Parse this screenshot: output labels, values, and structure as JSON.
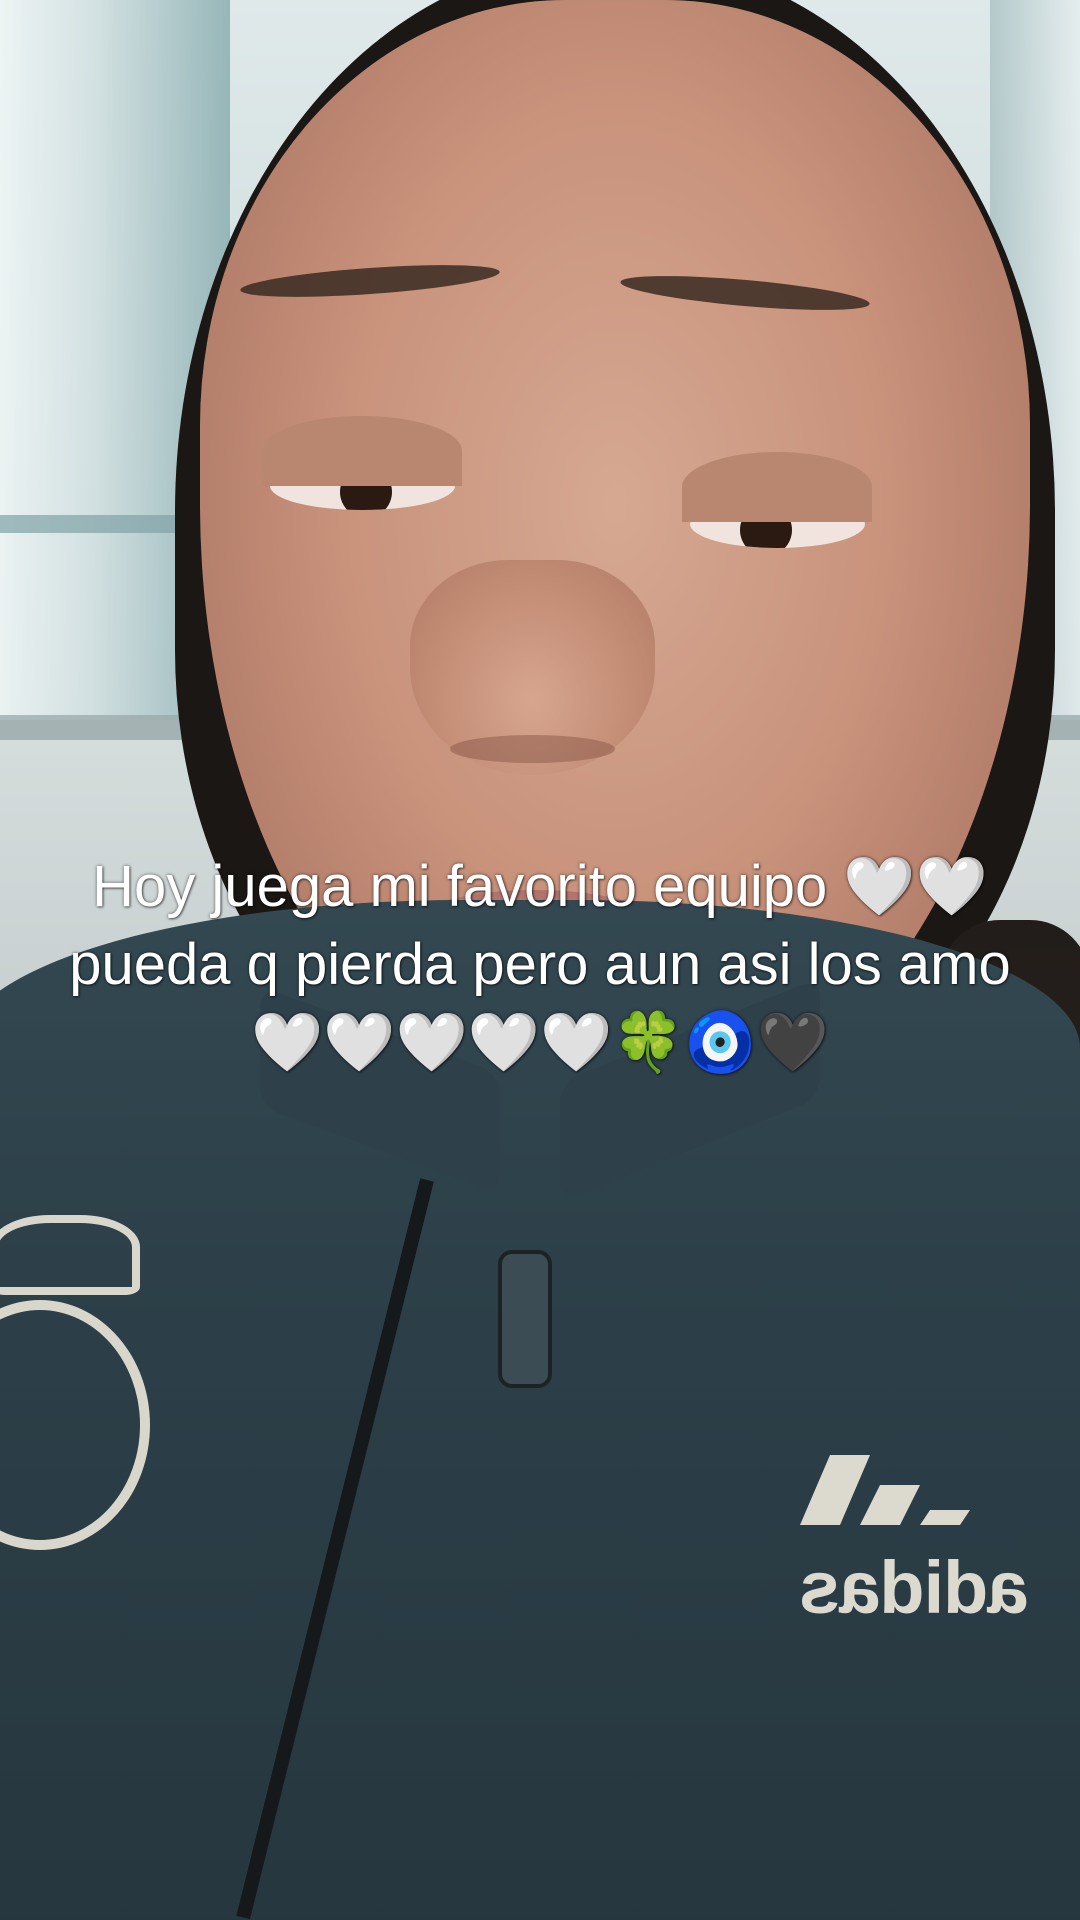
{
  "caption": {
    "text": "Hoy juega mi favorito equipo 🤍🤍pueda q pierda pero aun asi los amo🤍🤍🤍🤍🤍🍀🧿🖤"
  },
  "jacket": {
    "brand_text": "adidas"
  },
  "colors": {
    "jacket": "#2c3f48",
    "caption_text": "#ffffff",
    "logo": "#dcd9cf"
  }
}
